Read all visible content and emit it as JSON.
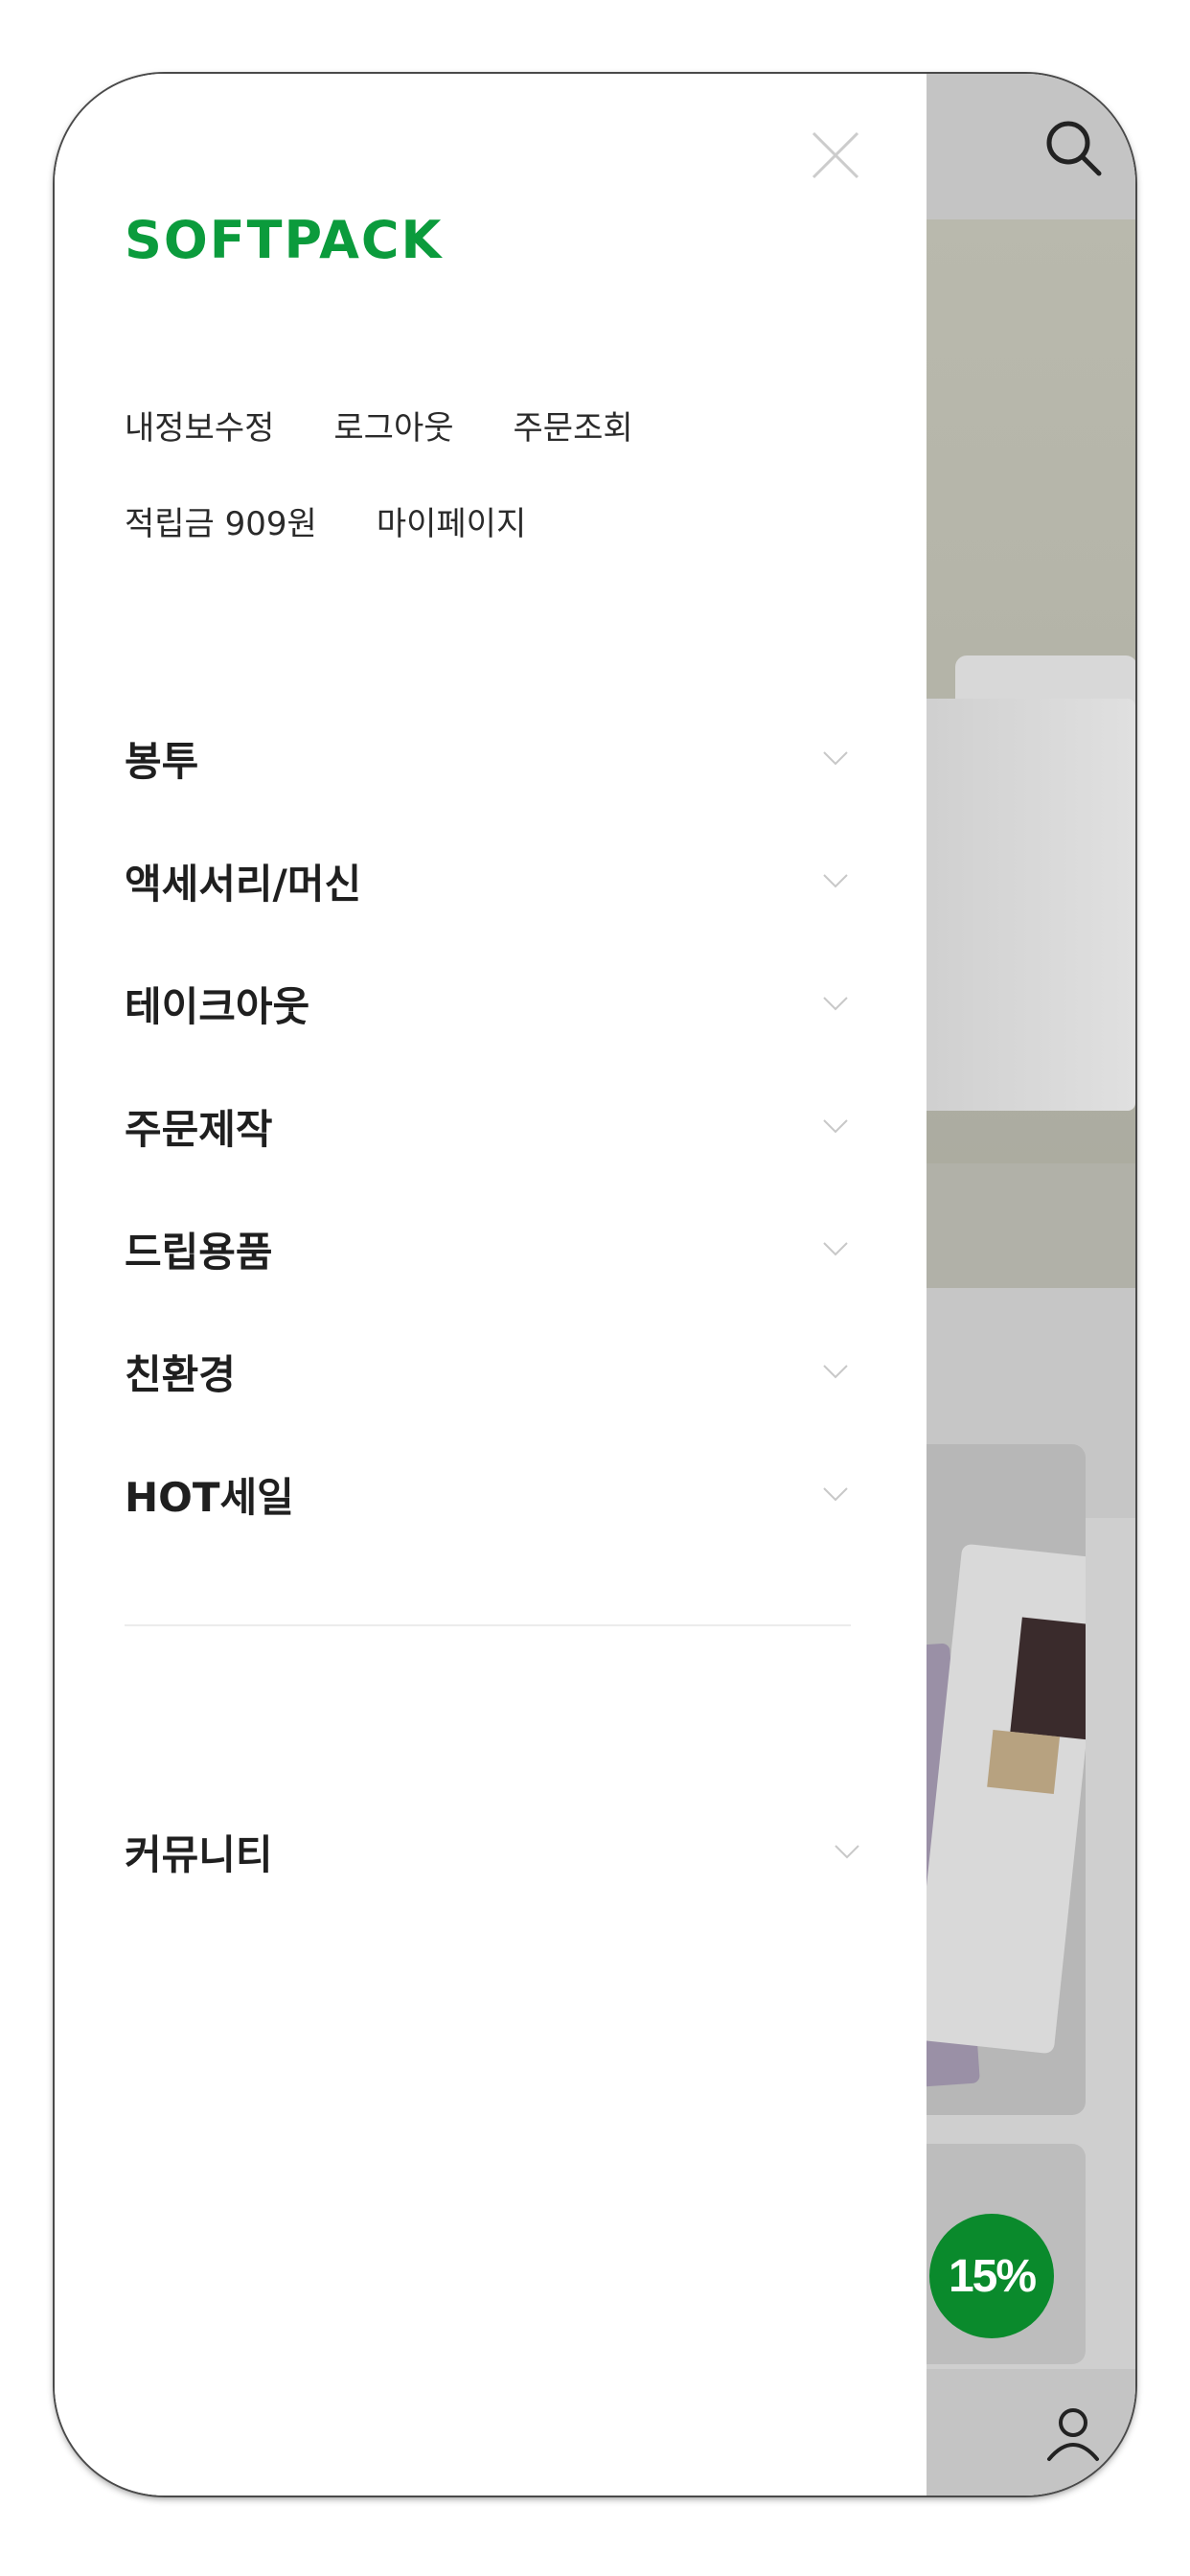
{
  "brand": {
    "logo_text": "SOFTPACK",
    "color": "#0b9b3c"
  },
  "account_links": {
    "edit_profile": "내정보수정",
    "logout": "로그아웃",
    "order_lookup": "주문조회",
    "points": "적립금 909원",
    "mypage": "마이페이지"
  },
  "menu": {
    "categories": [
      {
        "label": "봉투"
      },
      {
        "label": "액세서리/머신"
      },
      {
        "label": "테이크아웃"
      },
      {
        "label": "주문제작"
      },
      {
        "label": "드립용품"
      },
      {
        "label": "친환경"
      },
      {
        "label": "HOT세일"
      }
    ],
    "community": "커뮤니티"
  },
  "background": {
    "discount_badge": "15%",
    "badge_color": "#0a8a2c"
  },
  "icons": [
    "close-icon",
    "search-icon",
    "chevron-down-icon",
    "user-icon"
  ]
}
